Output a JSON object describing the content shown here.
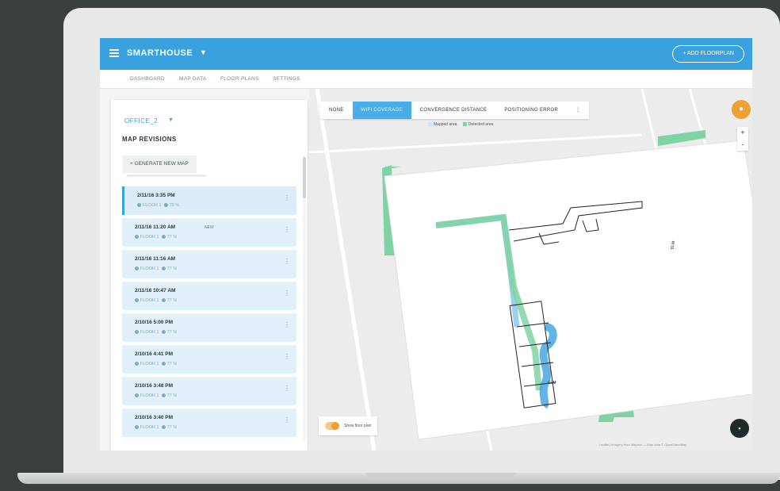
{
  "app": {
    "title": "SMARTHOUSE",
    "add_button": "+ ADD FLOORPLAN"
  },
  "nav": {
    "items": [
      "DASHBOARD",
      "MAP DATA",
      "FLOOR PLANS",
      "SETTINGS"
    ]
  },
  "panel": {
    "office": "OFFICE_2",
    "title": "MAP REVISIONS",
    "generate_button": "+ GENERATE NEW MAP",
    "revisions": [
      {
        "time": "2/11/16 3:35 PM",
        "meta_a": "FLOOR 1",
        "meta_b": "79 %",
        "tag": ""
      },
      {
        "time": "2/11/16 11:20 AM",
        "meta_a": "FLOOR 1",
        "meta_b": "77 %",
        "tag": "NEW"
      },
      {
        "time": "2/11/16 11:16 AM",
        "meta_a": "FLOOR 1",
        "meta_b": "77 %",
        "tag": ""
      },
      {
        "time": "2/11/16 10:47 AM",
        "meta_a": "FLOOR 1",
        "meta_b": "77 %",
        "tag": ""
      },
      {
        "time": "2/10/16 5:00 PM",
        "meta_a": "FLOOR 1",
        "meta_b": "77 %",
        "tag": ""
      },
      {
        "time": "2/10/16 4:41 PM",
        "meta_a": "FLOOR 1",
        "meta_b": "77 %",
        "tag": ""
      },
      {
        "time": "2/10/16 3:48 PM",
        "meta_a": "FLOOR 1",
        "meta_b": "77 %",
        "tag": ""
      },
      {
        "time": "2/10/16 3:40 PM",
        "meta_a": "FLOOR 1",
        "meta_b": "77 %",
        "tag": ""
      }
    ]
  },
  "map": {
    "tabs": [
      "NONE",
      "WIFI COVERAGE",
      "CONVERGENCE DISTANCE",
      "POSITIONING ERROR"
    ],
    "active_tab": 1,
    "more": "⋮",
    "legend": [
      "Mapped area",
      "Detected area"
    ],
    "legend_colors": [
      "#3aa1df",
      "#7fd3a2"
    ],
    "show_floorplan": "Show floor plan",
    "attribution": "Leaflet | Imagery from Mapbox — Map data © OpenStreetMap",
    "street_labels": [
      "ELM",
      "ELM"
    ],
    "zoom_in": "+",
    "zoom_out": "-"
  },
  "colors": {
    "brand": "#3aa1df",
    "accent": "#f0a030",
    "coverage": "#7fd3a2"
  }
}
